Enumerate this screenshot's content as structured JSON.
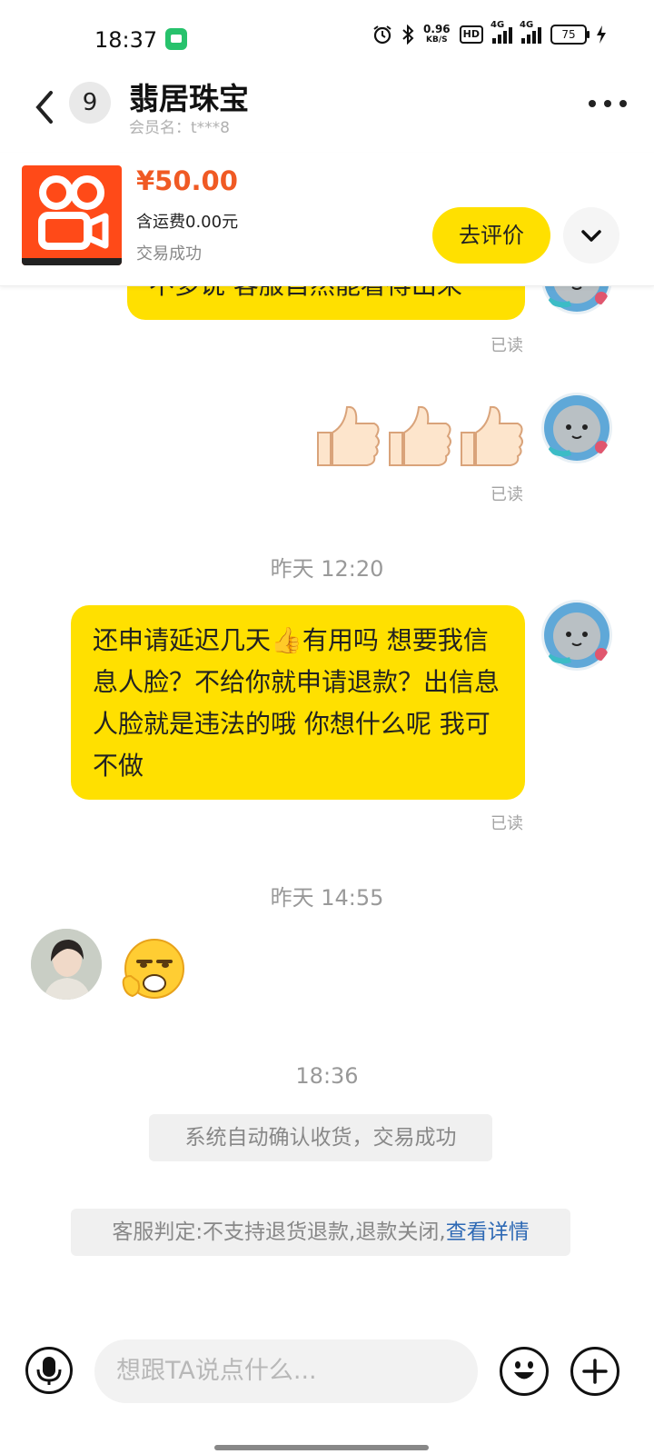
{
  "status_bar": {
    "time": "18:37",
    "net_speed_value": "0.96",
    "net_speed_unit": "KB/S",
    "hd_label": "HD",
    "sim1_label": "4G",
    "sim2_label": "4G",
    "battery": "75"
  },
  "header": {
    "unread_count": "9",
    "shop_name": "翡居珠宝",
    "member_label": "会员名：t***8"
  },
  "order": {
    "price": "¥50.00",
    "shipping": "含运费0.00元",
    "status": "交易成功",
    "review_button": "去评价"
  },
  "messages": {
    "partial_text": "不多说 客服自然能看得出来",
    "read_1": "已读",
    "read_2": "已读",
    "time_1": "昨天 12:20",
    "long_text": "还申请延迟几天👍有用吗  想要我信息人脸？不给你就申请退款？出信息人脸就是违法的哦 你想什么呢 我可不做",
    "read_3": "已读",
    "time_2": "昨天 14:55",
    "time_3": "18:36",
    "system_1": "系统自动确认收货，交易成功",
    "system_2_prefix": "客服判定:不支持退货退款,退款关闭,",
    "system_2_link": "查看详情"
  },
  "input_bar": {
    "placeholder": "想跟TA说点什么..."
  },
  "colors": {
    "accent_yellow": "#ffe000",
    "price_orange": "#f05a24",
    "link_blue": "#2f6ab5"
  }
}
